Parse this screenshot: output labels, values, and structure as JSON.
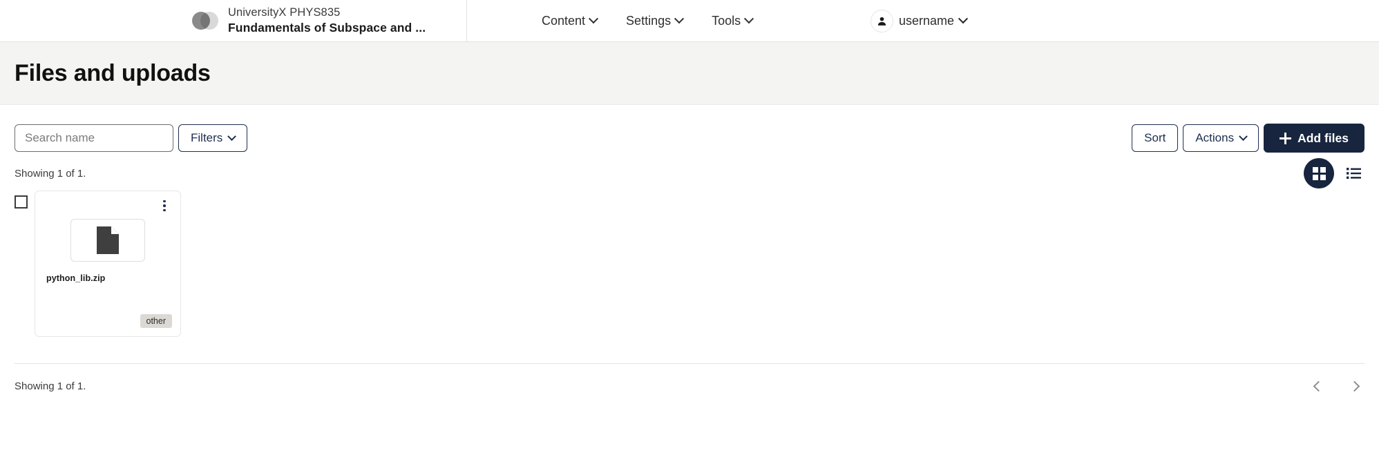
{
  "topnav": {
    "brand": {
      "logo_icon": "overlapping-circles-logo",
      "org": "UniversityX PHYS835",
      "course_title": "Fundamentals of Subspace and ..."
    },
    "menu": [
      {
        "label": "Content",
        "icon": "chevron-down-icon"
      },
      {
        "label": "Settings",
        "icon": "chevron-down-icon"
      },
      {
        "label": "Tools",
        "icon": "chevron-down-icon"
      }
    ],
    "account": {
      "avatar_icon": "person-icon",
      "username": "username",
      "caret_icon": "chevron-down-icon"
    }
  },
  "page": {
    "title": "Files and uploads"
  },
  "toolbar": {
    "search_placeholder": "Search name",
    "search_value": "",
    "search_icon": "search-input",
    "filters_label": "Filters",
    "sort_label": "Sort",
    "actions_label": "Actions",
    "add_files_label": "Add files",
    "add_files_icon": "plus-icon"
  },
  "results": {
    "count_text_top": "Showing 1 of 1.",
    "count_text_bottom": "Showing 1 of 1.",
    "view_modes": {
      "grid_icon": "grid-view-icon",
      "list_icon": "list-view-icon",
      "active": "grid"
    }
  },
  "files": [
    {
      "name": "python_lib.zip",
      "type_badge": "other",
      "thumb_icon": "document-file-icon",
      "menu_icon": "kebab-menu-icon",
      "selected": false
    }
  ],
  "pagination": {
    "prev_icon": "chevron-left-icon",
    "next_icon": "chevron-right-icon"
  },
  "colors": {
    "navy": "#17253f",
    "outline_navy": "#1d2d50",
    "band_gray": "#f4f4f3",
    "badge_gray": "#dcd9d4"
  }
}
